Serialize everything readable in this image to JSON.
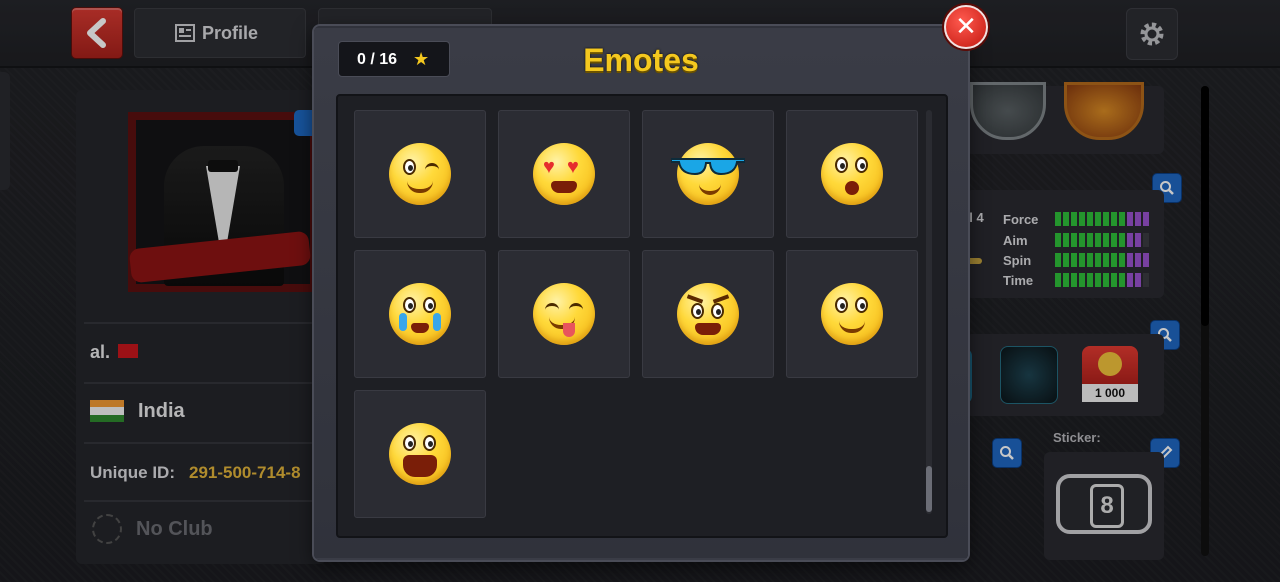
{
  "topbar": {
    "profile_tab": "Profile",
    "icons": [
      "back-arrow-icon",
      "profile-card-icon",
      "gear-icon"
    ]
  },
  "profile": {
    "name": "al.",
    "country": "India",
    "unique_id_label": "Unique ID:",
    "unique_id_value": "291-500-714-8",
    "club": "No Club"
  },
  "stats": {
    "level_fragment": "el 4",
    "labels": [
      "Force",
      "Aim",
      "Spin",
      "Time"
    ],
    "bars": [
      {
        "green": 9,
        "purple": 3,
        "empty": 0
      },
      {
        "green": 9,
        "purple": 2,
        "empty": 1
      },
      {
        "green": 9,
        "purple": 3,
        "empty": 0
      },
      {
        "green": 9,
        "purple": 2,
        "empty": 1
      }
    ]
  },
  "items": {
    "trophy_count": "1 000",
    "sticker_label": "Sticker:",
    "sticker_char": "8"
  },
  "modal": {
    "counter": "0 / 16",
    "title": "Emotes",
    "close_glyph": "✕",
    "emotes": [
      "wink",
      "heart-eyes",
      "cool-sunglasses",
      "surprised",
      "crying",
      "tongue-out",
      "angry",
      "smile-blush",
      "laughing"
    ]
  },
  "colors": {
    "title_yellow": "#f4c81f",
    "unique_id": "#e2b43a",
    "close_red": "#c2170f",
    "accent_blue": "#1f67c2"
  }
}
